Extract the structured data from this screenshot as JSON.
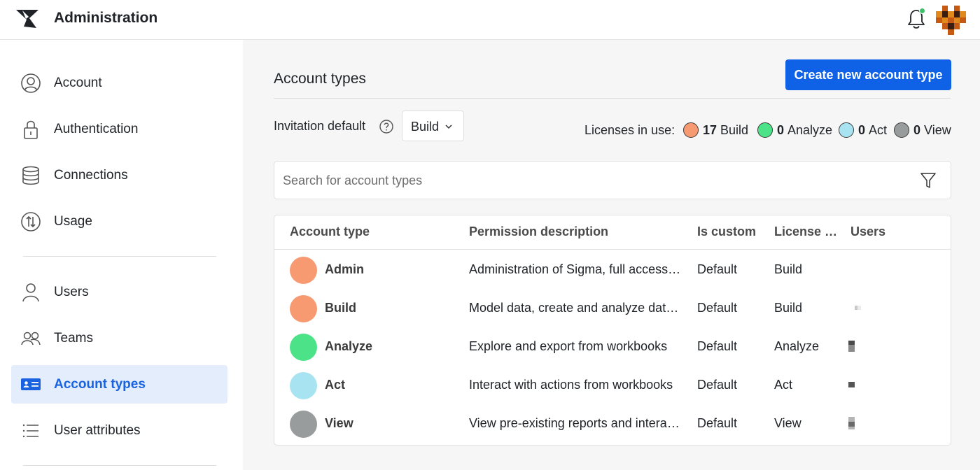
{
  "header": {
    "app_title": "Administration",
    "logo_icon": "sigma-logo-icon",
    "bell_icon": "bell-icon",
    "notification_dot_color": "#3fbf6a"
  },
  "sidebar": {
    "groups": [
      [
        {
          "label": "Account",
          "icon": "user-circle-icon"
        },
        {
          "label": "Authentication",
          "icon": "lock-icon"
        },
        {
          "label": "Connections",
          "icon": "database-icon"
        },
        {
          "label": "Usage",
          "icon": "usage-arrows-icon"
        }
      ],
      [
        {
          "label": "Users",
          "icon": "user-icon"
        },
        {
          "label": "Teams",
          "icon": "team-icon"
        },
        {
          "label": "Account types",
          "icon": "id-card-icon",
          "active": true
        },
        {
          "label": "User attributes",
          "icon": "list-icon"
        }
      ]
    ],
    "active_color": "#1a63e0"
  },
  "main": {
    "title": "Account types",
    "create_button_label": "Create new account type",
    "invitation": {
      "label": "Invitation default",
      "selected": "Build"
    },
    "licenses": {
      "label": "Licenses in use:",
      "items": [
        {
          "count": "17",
          "name": "Build",
          "color": "#f79a72"
        },
        {
          "count": "0",
          "name": "Analyze",
          "color": "#4ce388"
        },
        {
          "count": "0",
          "name": "Act",
          "color": "#a8e3f1"
        },
        {
          "count": "0",
          "name": "View",
          "color": "#999c9c"
        }
      ]
    },
    "search": {
      "placeholder": "Search for account types",
      "value": ""
    },
    "table": {
      "columns": [
        "Account type",
        "Permission description",
        "Is custom",
        "License …",
        "Users"
      ],
      "rows": [
        {
          "name": "Admin",
          "color": "#f79a72",
          "description": "Administration of Sigma, full access to all features",
          "custom": "Default",
          "license": "Build"
        },
        {
          "name": "Build",
          "color": "#f79a72",
          "description": "Model data, create and analyze data in workbooks",
          "custom": "Default",
          "license": "Build"
        },
        {
          "name": "Analyze",
          "color": "#4ce388",
          "description": "Explore and export from workbooks",
          "custom": "Default",
          "license": "Analyze"
        },
        {
          "name": "Act",
          "color": "#a8e3f1",
          "description": "Interact with actions from workbooks",
          "custom": "Default",
          "license": "Act"
        },
        {
          "name": "View",
          "color": "#999c9c",
          "description": "View pre-existing reports and interact with them",
          "custom": "Default",
          "license": "View"
        }
      ]
    }
  }
}
